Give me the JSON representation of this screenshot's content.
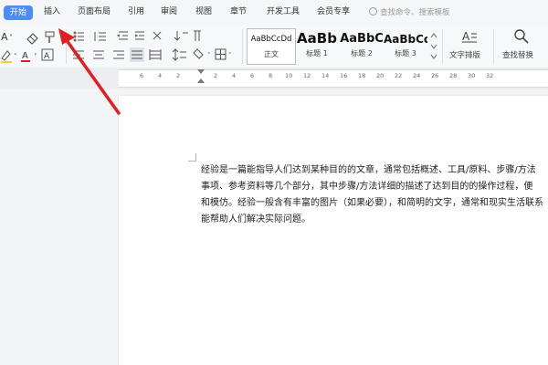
{
  "menubar": {
    "tabs": [
      "开始",
      "插入",
      "页面布局",
      "引用",
      "审阅",
      "视图",
      "章节",
      "开发工具",
      "会员专享"
    ],
    "active_tab": "开始",
    "search_placeholder": "查找命令、搜索模板"
  },
  "ribbon": {
    "styles": [
      {
        "sample": "AaBbCcDd",
        "label": "正文"
      },
      {
        "sample": "AaBb",
        "label": "标题 1"
      },
      {
        "sample": "AaBbC",
        "label": "标题 2"
      },
      {
        "sample": "AaBbCc",
        "label": "标题 3"
      }
    ],
    "text_layout_label": "文字排版",
    "find_replace_label": "查找替换"
  },
  "ruler": {
    "numbers": [
      "6",
      "4",
      "2",
      "2",
      "4",
      "6",
      "8",
      "10",
      "12",
      "14",
      "16",
      "18",
      "20",
      "22",
      "24",
      "26",
      "28",
      "30",
      "32"
    ]
  },
  "document": {
    "lines": [
      "经验是一篇能指导人们达到某种目的的文章，通常包括概述、工具/原料、步骤/方法",
      "事项、参考资料等几个部分，其中步骤/方法详细的描述了达到目的的操作过程，便",
      "和模仿。经验一般含有丰富的图片（如果必要），和简明的文字，通常和现实生活联系",
      "能帮助人们解决实际问题。"
    ]
  },
  "annotation": {
    "arrow_color": "#e02020"
  }
}
